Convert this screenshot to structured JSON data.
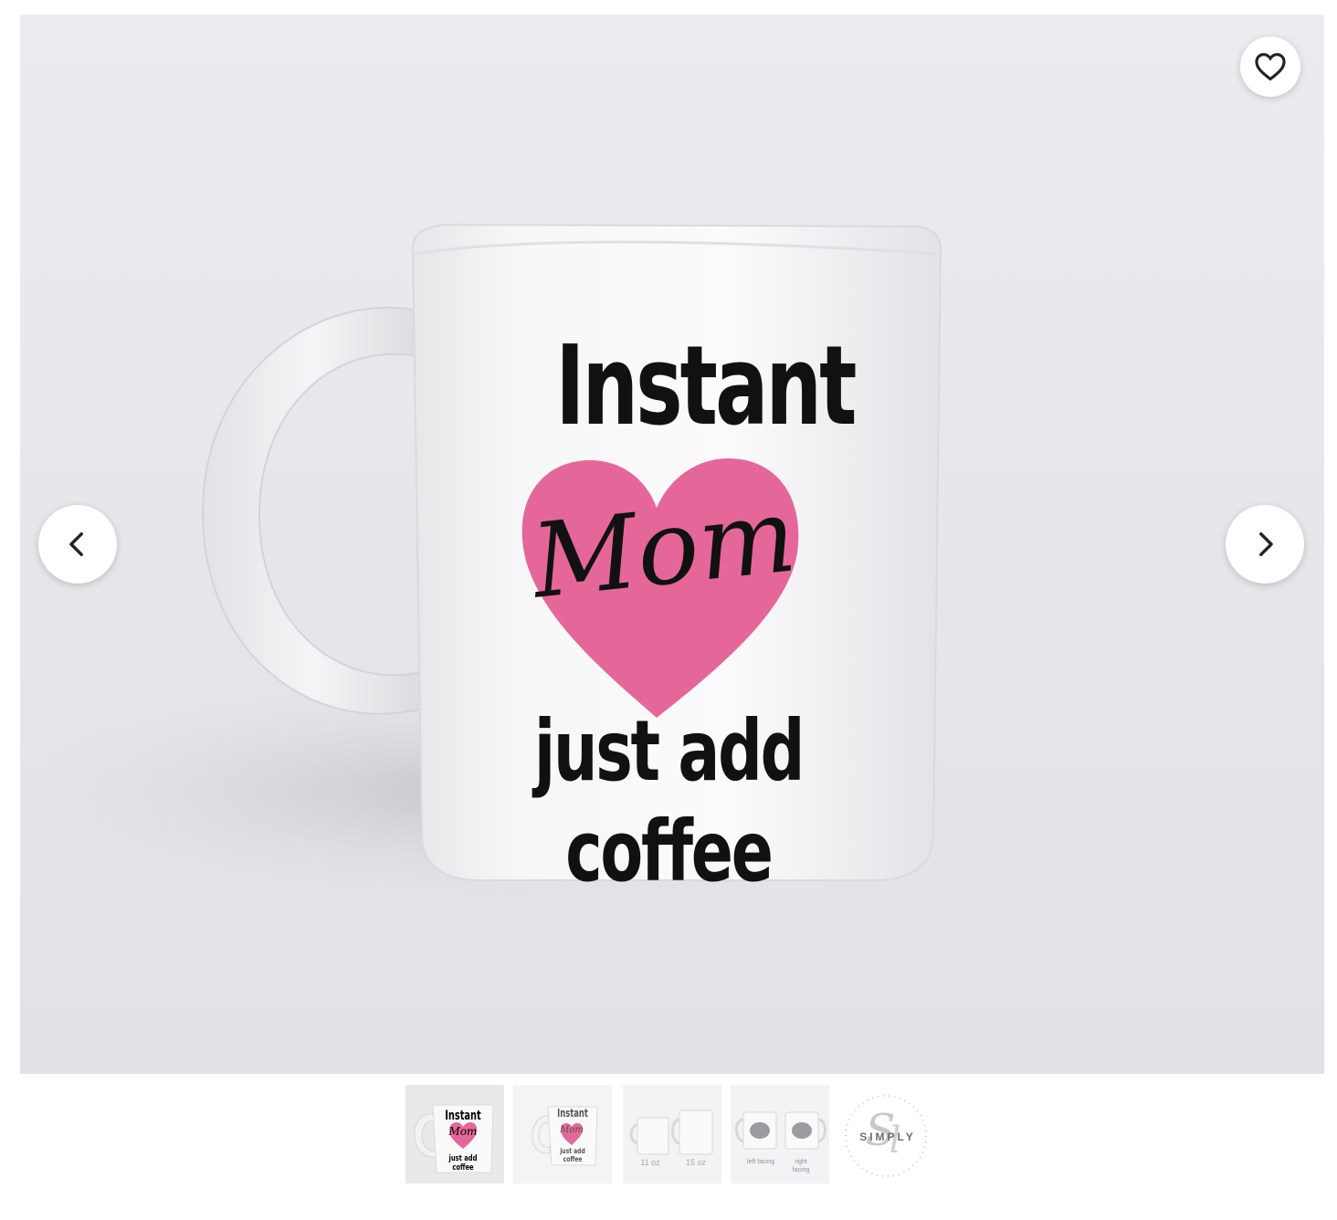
{
  "gallery": {
    "favorite_label": "Add to favorites",
    "prev_label": "Previous image",
    "next_label": "Next image",
    "active_index": 0,
    "main_image": {
      "line1": "Instant",
      "line2": "Mom",
      "line3": "just add coffee",
      "heart_color": "#e5679a",
      "text_color": "#111111"
    },
    "thumbnails": [
      {
        "kind": "mug-front",
        "line1": "Instant",
        "line2": "Mom",
        "line3": "just add coffee"
      },
      {
        "kind": "mug-front",
        "line1": "Instant",
        "line2": "Mom",
        "line3": "just add coffee"
      },
      {
        "kind": "sizes",
        "size_small": "11 oz",
        "size_large": "15 oz"
      },
      {
        "kind": "facing",
        "left_label": "left facing",
        "right_label": "right facing"
      },
      {
        "kind": "logo",
        "logo_text": "SIMPLY"
      }
    ]
  }
}
